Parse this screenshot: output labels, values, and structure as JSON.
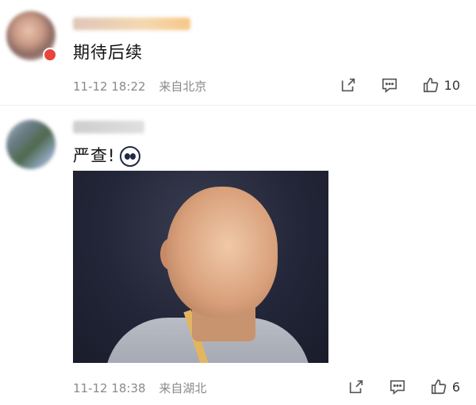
{
  "comments": [
    {
      "text": "期待后续",
      "timestamp": "11-12 18:22",
      "location": "来自北京",
      "likes": "10",
      "actions": [
        "share-icon",
        "reply-icon",
        "like-icon"
      ]
    },
    {
      "text": "严查!",
      "timestamp": "11-12 18:38",
      "location": "来自湖北",
      "likes": "6",
      "actions": [
        "share-icon",
        "reply-icon",
        "like-icon"
      ]
    }
  ]
}
